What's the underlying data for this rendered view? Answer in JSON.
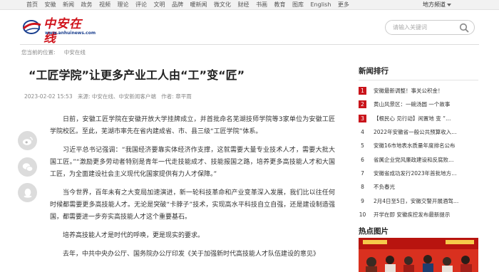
{
  "topnav": {
    "links": [
      "首页",
      "安徽",
      "新闻",
      "政务",
      "视频",
      "理论",
      "评论",
      "文明",
      "品牌",
      "暖新闻",
      "微文化",
      "财经",
      "书画",
      "教育",
      "图库",
      "English",
      "更多"
    ],
    "region": "地方频道"
  },
  "header": {
    "logo_text": "中安在线",
    "logo_url": "www.anhuinews.com",
    "search_placeholder": "请输入关键词"
  },
  "breadcrumb": {
    "prefix": "您当前的位置:",
    "current": "中安在线"
  },
  "article": {
    "title": "“工匠学院”让更多产业工人由“工”变“匠”",
    "date": "2023-02-02 15:53",
    "source": "来源: 中安在线、中安新闻客户端",
    "author": "作者: 章平雨",
    "paragraphs": [
      "日前，安徽工匠学院在安徽开放大学挂牌成立，并首批命名芜湖技师学院等3家单位为安徽工匠学院校区。至此，芜湖市率先在省内建成省、市、县三级“工匠学院”体系。",
      "习近平总书记强调：“我国经济要靠实体经济作支撑，这就需要大量专业技术人才，需要大批大国工匠。”“激励更多劳动者特别是青年一代走技能成才、技能报国之路，培养更多高技能人才和大国工匠，为全面建设社会主义现代化国家提供有力人才保障。”",
      "当今世界，百年未有之大变局加速演进，新一轮科技革命和产业变革深入发展，我们比以往任何时候都需要更多高技能人才。无论是突破“卡脖子”技术，实现高水平科技自立自强，还是建设制造强国，都需要进一步夯实高技能人才这个重要基石。",
      "培养高技能人才是时代的呼唤，更是现实的要求。",
      "去年，中共中央办公厅、国务院办公厅印发《关于加强新时代高技能人才队伍建设的意见》"
    ]
  },
  "sidebar": {
    "ranking_title": "新闻排行",
    "ranking": [
      {
        "num": "1",
        "text": "安徽最新调整！事关公积金！"
      },
      {
        "num": "2",
        "text": "黄山风景区：一碗汤圆 一个故事"
      },
      {
        "num": "3",
        "text": "【根民心 见行动】闲置地 变 “…"
      },
      {
        "num": "4",
        "text": "2022年安徽省一般公共预算收入…"
      },
      {
        "num": "5",
        "text": "安徽16市地表水质量年度排名公布"
      },
      {
        "num": "6",
        "text": "省属企业党风廉政建设和反腐败…"
      },
      {
        "num": "7",
        "text": "安徽省成功发行2023年首批地方…"
      },
      {
        "num": "8",
        "text": "不负春光"
      },
      {
        "num": "9",
        "text": "2月4日至5日，安徽交警开展酒驾…"
      },
      {
        "num": "10",
        "text": "开学在即 安徽疾控发布最新提示"
      }
    ],
    "hotpic_title": "热点图片"
  },
  "colors": {
    "brand_red": "#c9141b",
    "link_blue": "#1a3f8f"
  }
}
